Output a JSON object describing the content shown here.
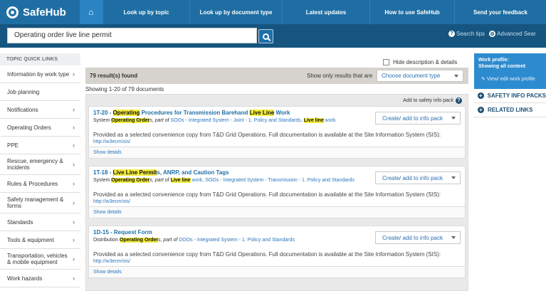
{
  "brand": {
    "name": "SafeHub"
  },
  "nav": [
    "Look up by topic",
    "Look up by document type",
    "Latest updates",
    "How to use SafeHub",
    "Send your feedback"
  ],
  "search": {
    "value": "Operating order live line permit",
    "tips": "Search tips",
    "advanced": "Advanced Sear"
  },
  "sidebar": {
    "heading": "TOPIC QUICK LINKS",
    "items": [
      "Information by work type",
      "Job planning",
      "Notifications",
      "Operating Orders",
      "PPE",
      "Rescue, emergency & incidents",
      "Rules & Procedures",
      "Safety management & forms",
      "Standards",
      "Tools & equipment",
      "Transportation, vehicles & mobile equipment",
      "Work hazards"
    ]
  },
  "main": {
    "hide_desc": "Hide description & details",
    "results": "79 result(s) found",
    "show_only": "Show only results that are",
    "doctype": "Choose document type",
    "showing": "Showing 1-20 of 79 documents",
    "add_safety": "Add to safety info pack",
    "create_label": "Create/ add to info pack",
    "details_label": "Show details",
    "cards": [
      {
        "code": "1T-20 - ",
        "t1": "Operating",
        "t2": " Procedures for Transmission Barehand ",
        "t3": "Live Line",
        "t4": " Work",
        "s_pre": "System ",
        "s_hl": "Operating Order",
        "s_mid": "s, part of ",
        "s_link": "SOOs - Integrated System - Joint - 1. Policy and Standards, ",
        "s_hl2": "Live line",
        "s_end": " work",
        "desc": "Provided as a selected convenience copy from T&D Grid Operations. Full documentation is available at the Site Information System (SIS):",
        "url": "http://w3ecm/sis/"
      },
      {
        "code": "1T-18 - ",
        "t1": "Live Line Permit",
        "t2": "s, ANRP, and Caution Tags",
        "t3": "",
        "t4": "",
        "s_pre": "System ",
        "s_hl": "Operating Order",
        "s_mid": "s, part of ",
        "s_link": "",
        "s_hl2": "Live line",
        "s_end": " work, SOOs - Integrated System - Transmission - 1. Policy and Standards",
        "desc": "Provided as a selected convenience copy from T&D Grid Operations. Full documentation is available at the Site Information System (SIS):",
        "url": "http://w3ecm/sis/"
      },
      {
        "code": "1D-15 - Request Form",
        "t1": "",
        "t2": "",
        "t3": "",
        "t4": "",
        "s_pre": "Distribution ",
        "s_hl": "Operating Order",
        "s_mid": "s, part of ",
        "s_link": "DOOs - Integrated System - 1. Policy and Standards",
        "s_hl2": "",
        "s_end": "",
        "desc": "Provided as a selected convenience copy from T&D Grid Operations. Full documentation is available at the Site Information System (SIS):",
        "url": "http://w3ecm/sis/"
      }
    ]
  },
  "right": {
    "profile_title": "Work profile:",
    "profile_sub": "Showing all content",
    "edit": "View/ edit work profile",
    "links": [
      "SAFETY INFO PACKS",
      "RELATED LINKS"
    ]
  }
}
